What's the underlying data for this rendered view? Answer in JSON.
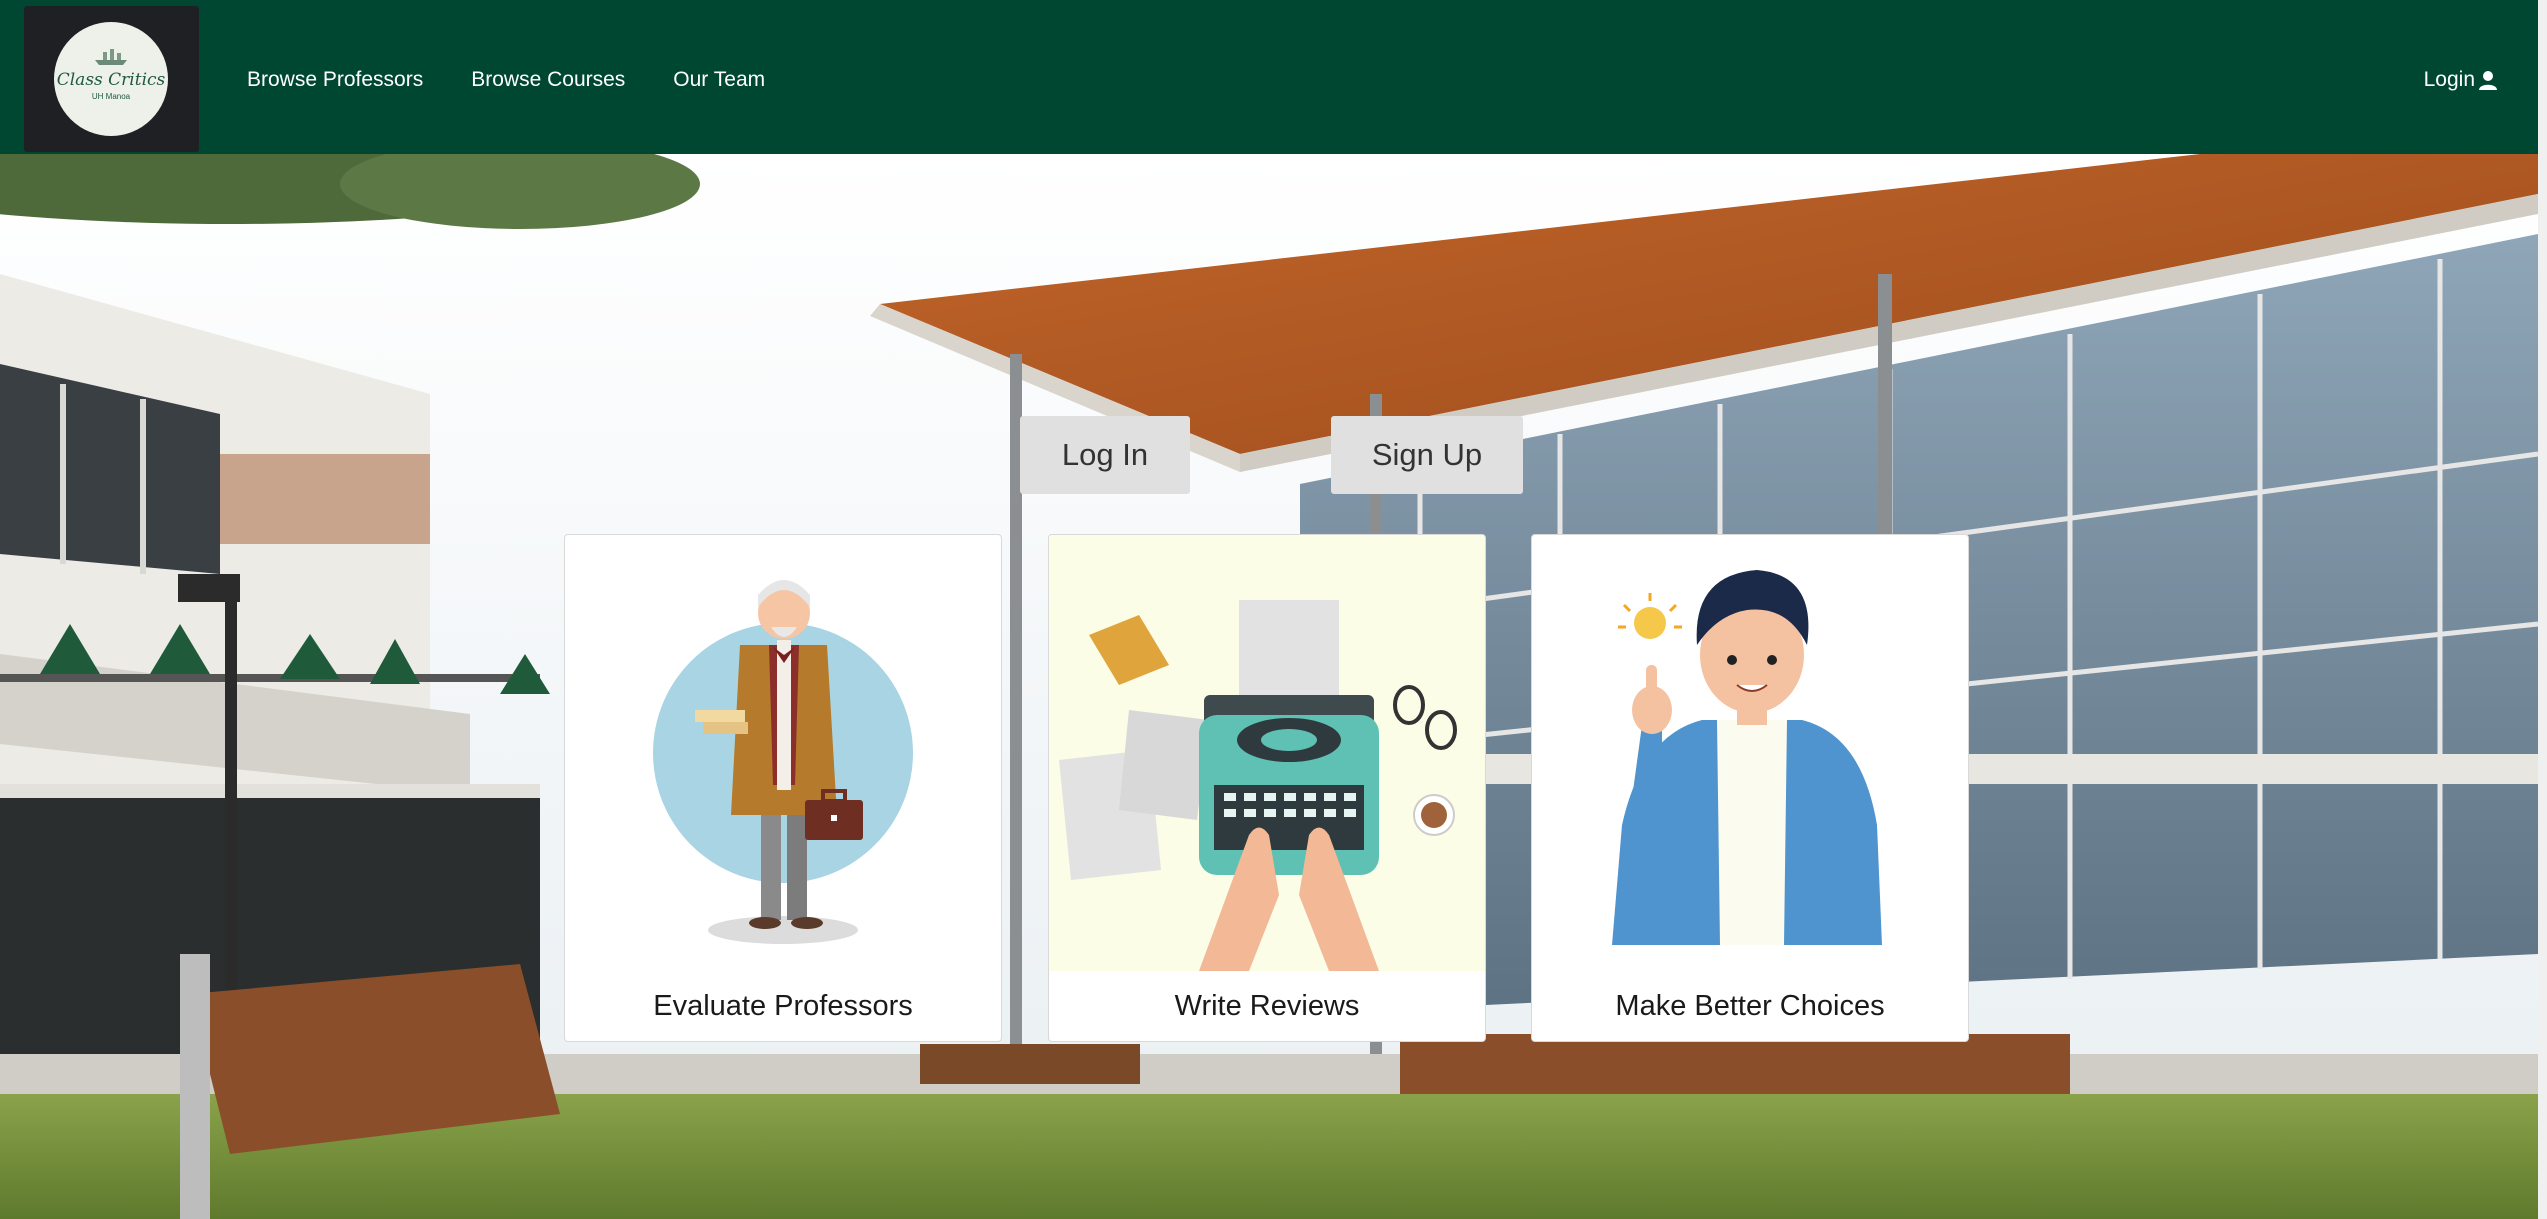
{
  "navbar": {
    "logo": {
      "title": "Class Critics",
      "subtitle": "UH Manoa"
    },
    "links": [
      "Browse Professors",
      "Browse Courses",
      "Our Team"
    ],
    "login_label": "Login"
  },
  "hero": {
    "buttons": {
      "login": "Log In",
      "signup": "Sign Up"
    },
    "cards": [
      {
        "caption": "Evaluate Professors",
        "icon": "professor-illustration"
      },
      {
        "caption": "Write Reviews",
        "icon": "typewriter-illustration"
      },
      {
        "caption": "Make Better Choices",
        "icon": "idea-person-illustration"
      }
    ]
  },
  "colors": {
    "navbar": "#004731",
    "logo_box": "#1f2023",
    "button": "#e0e0e0",
    "card": "#ffffff"
  }
}
